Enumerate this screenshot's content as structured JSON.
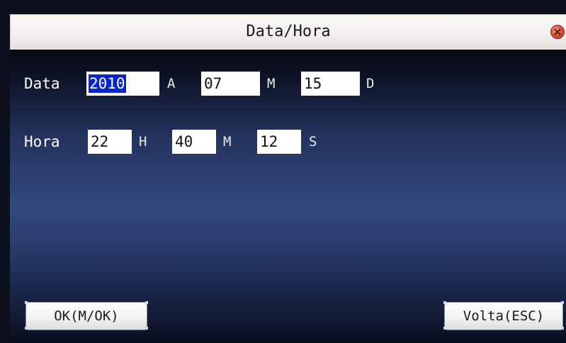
{
  "window": {
    "title": "Data/Hora"
  },
  "date": {
    "label": "Data",
    "year": {
      "value": "2010",
      "unit": "A"
    },
    "month": {
      "value": "07",
      "unit": "M"
    },
    "day": {
      "value": "15",
      "unit": "D"
    }
  },
  "time": {
    "label": "Hora",
    "hour": {
      "value": "22",
      "unit": "H"
    },
    "minute": {
      "value": "40",
      "unit": "M"
    },
    "second": {
      "value": "12",
      "unit": "S"
    }
  },
  "buttons": {
    "ok": "OK(M/OK)",
    "back": "Volta(ESC)"
  },
  "colors": {
    "selection": "#0a24d4",
    "background": "#2c3e70"
  },
  "icons": {
    "close": "close-icon"
  }
}
